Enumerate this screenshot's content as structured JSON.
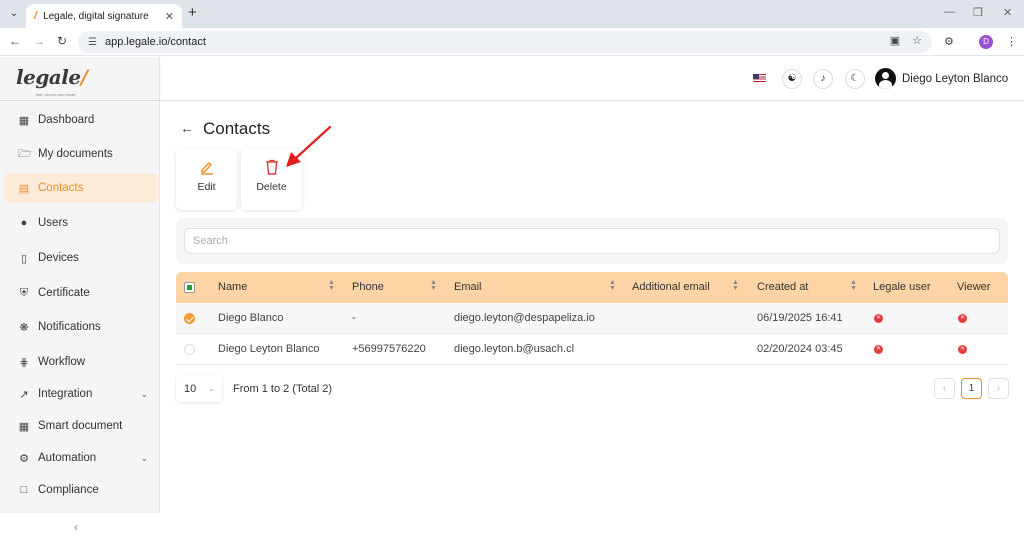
{
  "browser": {
    "tab_title": "Legale, digital signature",
    "tab_favicon": "pencil-icon",
    "url": "app.legale.io/contact",
    "profile_initial": "D"
  },
  "logo": {
    "text": "legale",
    "tagline": "fast, secure and smart"
  },
  "sidebar": {
    "items": [
      {
        "label": "Dashboard",
        "icon": "dashboard-icon"
      },
      {
        "label": "My documents",
        "icon": "folder-icon"
      },
      {
        "label": "Contacts",
        "icon": "contacts-icon",
        "active": true
      },
      {
        "label": "Users",
        "icon": "user-circle-icon"
      },
      {
        "label": "Devices",
        "icon": "device-icon"
      },
      {
        "label": "Certificate",
        "icon": "shield-icon"
      },
      {
        "label": "Notifications",
        "icon": "bell-icon"
      },
      {
        "label": "Workflow",
        "icon": "workflow-icon"
      },
      {
        "label": "Integration",
        "icon": "external-link-icon",
        "expandable": true
      },
      {
        "label": "Smart document",
        "icon": "grid-icon"
      },
      {
        "label": "Automation",
        "icon": "gear-icon",
        "expandable": true
      },
      {
        "label": "Compliance",
        "icon": "chat-icon"
      }
    ],
    "collapse_icon": "chevron-left-icon"
  },
  "header": {
    "language_flag": "us-flag-icon",
    "icons": [
      "headset-icon",
      "bell-icon",
      "moon-icon"
    ],
    "user_name": "Diego Leyton Blanco"
  },
  "page": {
    "title": "Contacts",
    "actions": {
      "edit_label": "Edit",
      "delete_label": "Delete"
    },
    "search_placeholder": "Search"
  },
  "table": {
    "columns": [
      "Name",
      "Phone",
      "Email",
      "Additional email",
      "Created at",
      "Legale user",
      "Viewer"
    ],
    "rows": [
      {
        "checked": true,
        "name": "Diego Blanco",
        "phone": "-",
        "email": "diego.leyton@despapeliza.io",
        "additional_email": "",
        "created_at": "06/19/2025 16:41",
        "legale_user": false,
        "viewer": false
      },
      {
        "checked": false,
        "name": "Diego Leyton Blanco",
        "phone": "+56997576220",
        "email": "diego.leyton.b@usach.cl",
        "additional_email": "",
        "created_at": "02/20/2024 03:45",
        "legale_user": false,
        "viewer": false
      }
    ]
  },
  "pagination": {
    "page_size": "10",
    "range_text": "From 1 to 2 (Total 2)",
    "current_page": "1"
  },
  "colors": {
    "accent": "#f08c24",
    "table_header": "#fdd4a5",
    "annotation_arrow": "#e0201e",
    "badge_red": "#e03c3c"
  }
}
